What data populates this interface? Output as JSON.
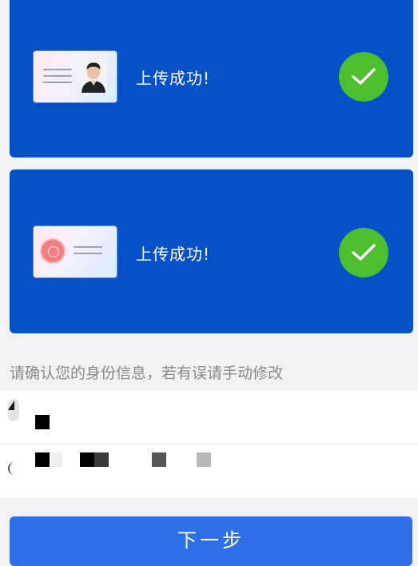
{
  "uploads": [
    {
      "side": "portrait",
      "status": "上传成功!",
      "icon": "check-circle-icon"
    },
    {
      "side": "emblem",
      "status": "上传成功!",
      "icon": "check-circle-icon"
    }
  ],
  "hint": "请确认您的身份信息，若有误请手动修改",
  "form": {
    "name_field": {
      "value": ""
    },
    "id_field": {
      "value": ""
    }
  },
  "next_button": {
    "label": "下一步"
  },
  "colors": {
    "card_blue": "#0650c8",
    "check_green": "#4cbe2f",
    "button_blue": "#2d6fe6"
  }
}
